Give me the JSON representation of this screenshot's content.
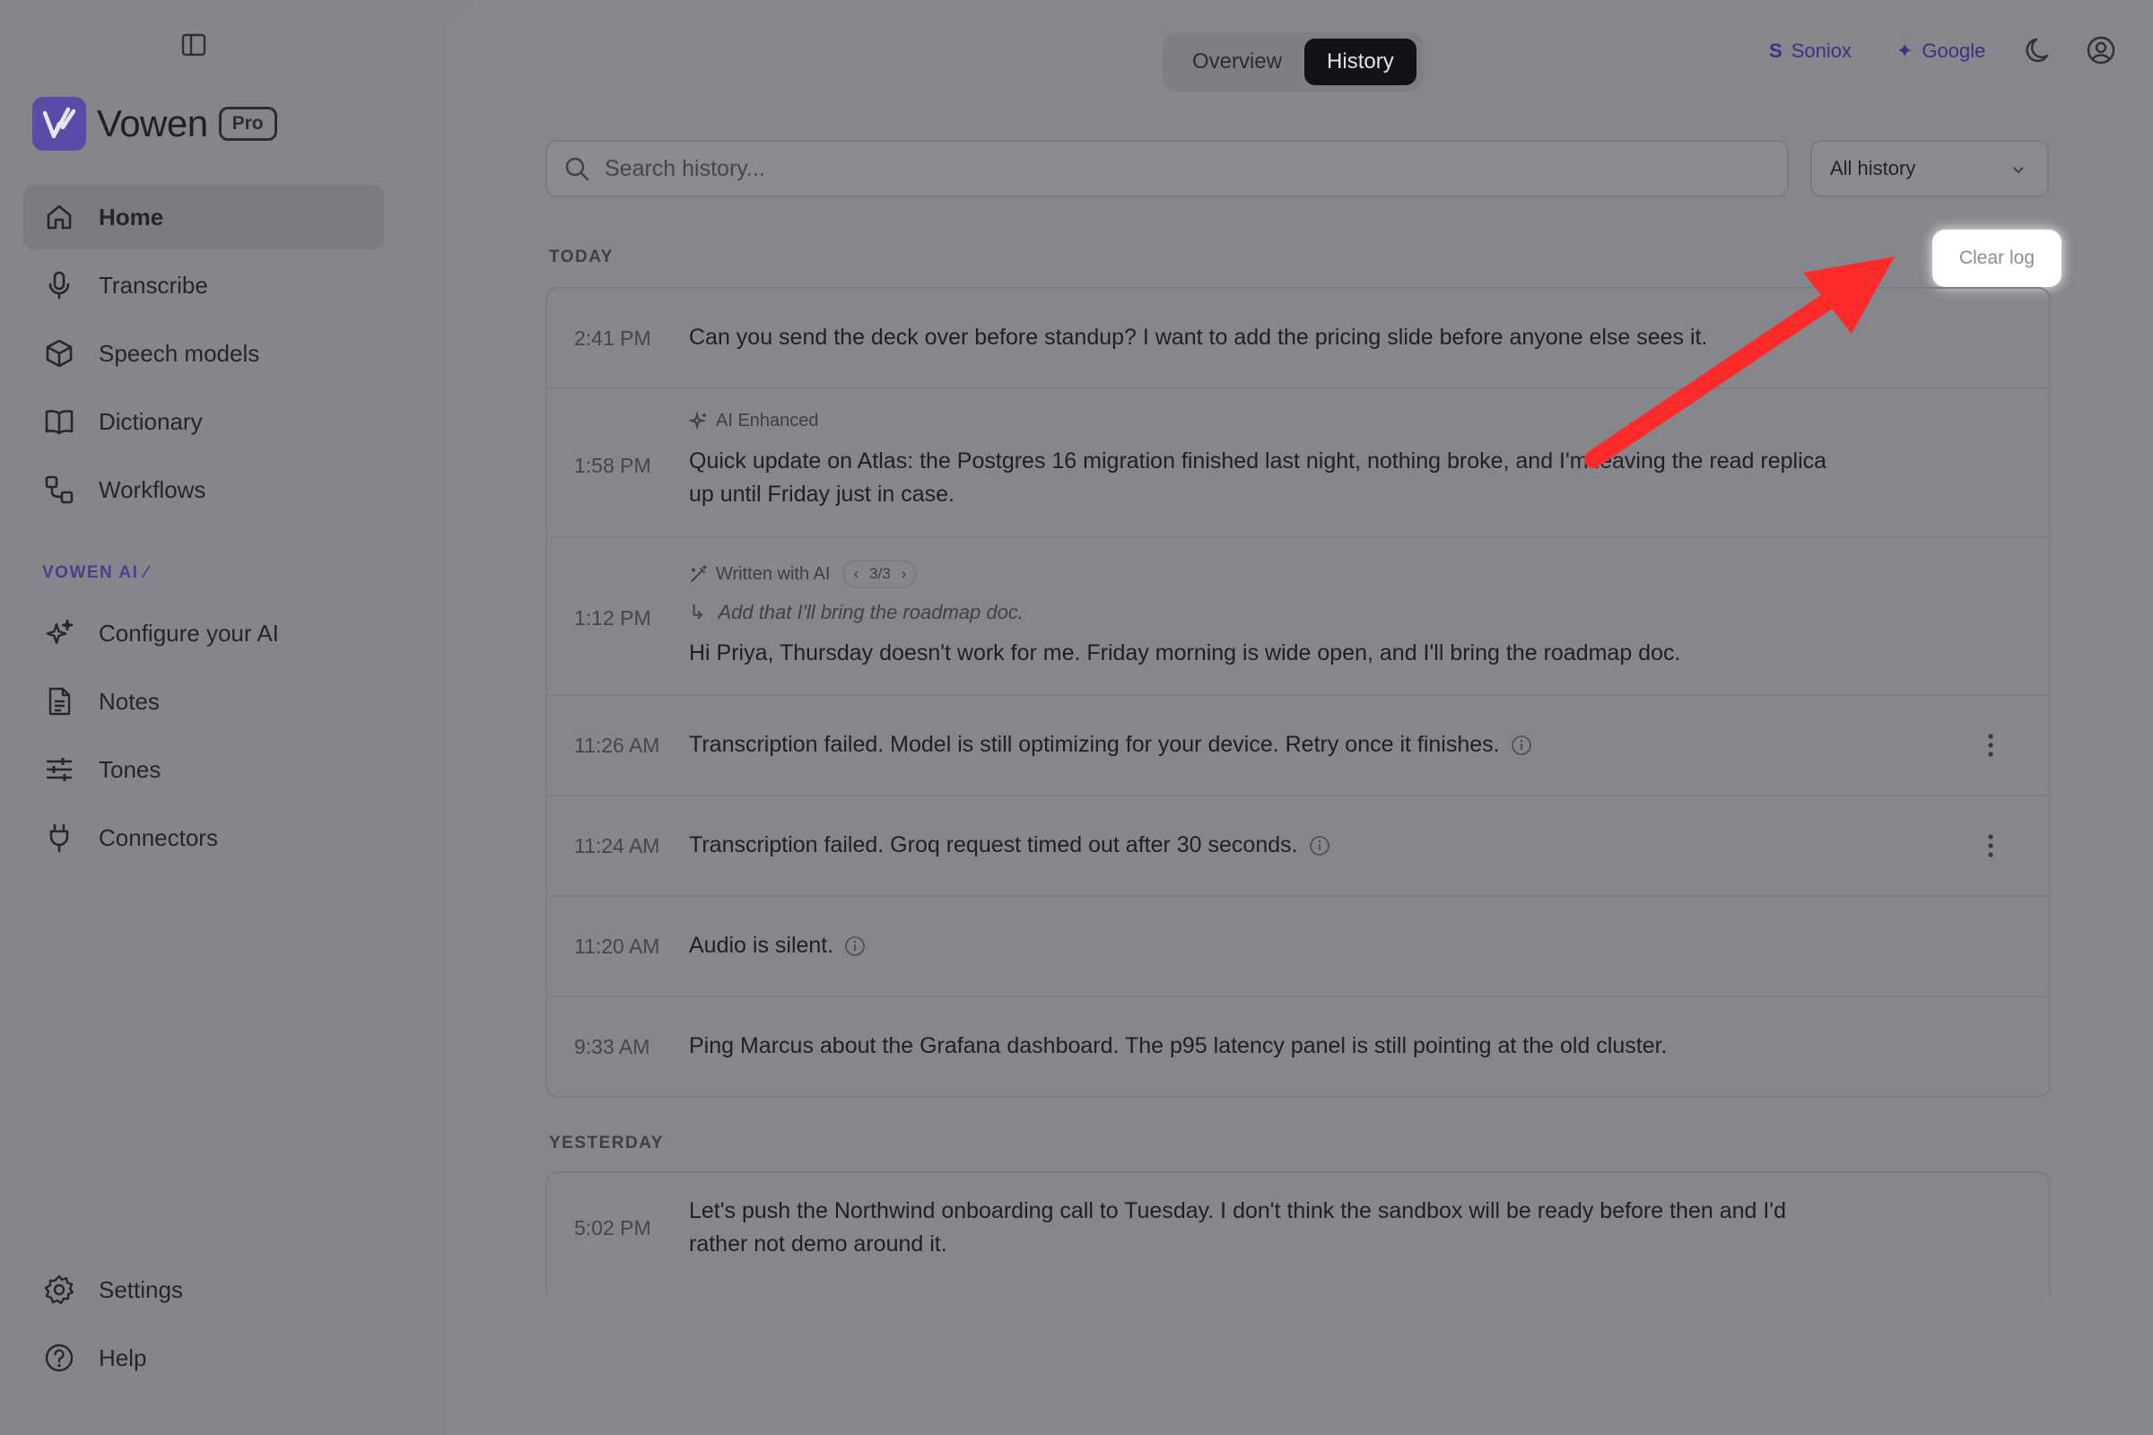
{
  "app": {
    "name": "Vowen",
    "plan_badge": "Pro"
  },
  "sidebar": {
    "main_items": [
      {
        "label": "Home",
        "icon": "home-icon",
        "active": true
      },
      {
        "label": "Transcribe",
        "icon": "mic-icon"
      },
      {
        "label": "Speech models",
        "icon": "cube-icon"
      },
      {
        "label": "Dictionary",
        "icon": "book-icon"
      },
      {
        "label": "Workflows",
        "icon": "workflow-icon"
      }
    ],
    "ai_section_label": "VOWEN AI",
    "ai_items": [
      {
        "label": "Configure your AI",
        "icon": "sparkles-icon"
      },
      {
        "label": "Notes",
        "icon": "notes-icon"
      },
      {
        "label": "Tones",
        "icon": "sliders-icon"
      },
      {
        "label": "Connectors",
        "icon": "plug-icon"
      }
    ],
    "bottom_items": [
      {
        "label": "Settings",
        "icon": "gear-icon"
      },
      {
        "label": "Help",
        "icon": "help-icon"
      }
    ]
  },
  "header": {
    "tabs": [
      {
        "label": "Overview"
      },
      {
        "label": "History",
        "active": true
      }
    ],
    "providers": [
      {
        "glyph": "S",
        "label": "Soniox"
      },
      {
        "glyph": "✦",
        "label": "Google"
      }
    ]
  },
  "search": {
    "placeholder": "Search history..."
  },
  "filter": {
    "selected": "All history"
  },
  "clear_log_label": "Clear log",
  "groups": [
    {
      "label": "TODAY",
      "entries": [
        {
          "time": "2:41 PM",
          "text": "Can you send the deck over before standup? I want to add the pricing slide before anyone else sees it."
        },
        {
          "time": "1:58 PM",
          "badge": "AI Enhanced",
          "text": "Quick update on Atlas: the Postgres 16 migration finished last night, nothing broke, and I'm leaving the read replica up until Friday just in case."
        },
        {
          "time": "1:12 PM",
          "badge": "Written with AI",
          "pager": "3/3",
          "instruction": "Add that I'll bring the roadmap doc.",
          "text": "Hi Priya, Thursday doesn't work for me. Friday morning is wide open, and I'll bring the roadmap doc."
        },
        {
          "time": "11:26 AM",
          "text": "Transcription failed. Model is still optimizing for your device. Retry once it finishes."
        },
        {
          "time": "11:24 AM",
          "text": "Transcription failed. Groq request timed out after 30 seconds."
        },
        {
          "time": "11:20 AM",
          "text": "Audio is silent."
        },
        {
          "time": "9:33 AM",
          "text": "Ping Marcus about the Grafana dashboard. The p95 latency panel is still pointing at the old cluster."
        }
      ]
    },
    {
      "label": "YESTERDAY",
      "entries": [
        {
          "time": "5:02 PM",
          "text": "Let's push the Northwind onboarding call to Tuesday. I don't think the sandbox will be ready before then and I'd rather not demo around it."
        }
      ]
    }
  ],
  "colors": {
    "accent": "#5b4aa8",
    "annotation_arrow": "#ff2a2a"
  }
}
